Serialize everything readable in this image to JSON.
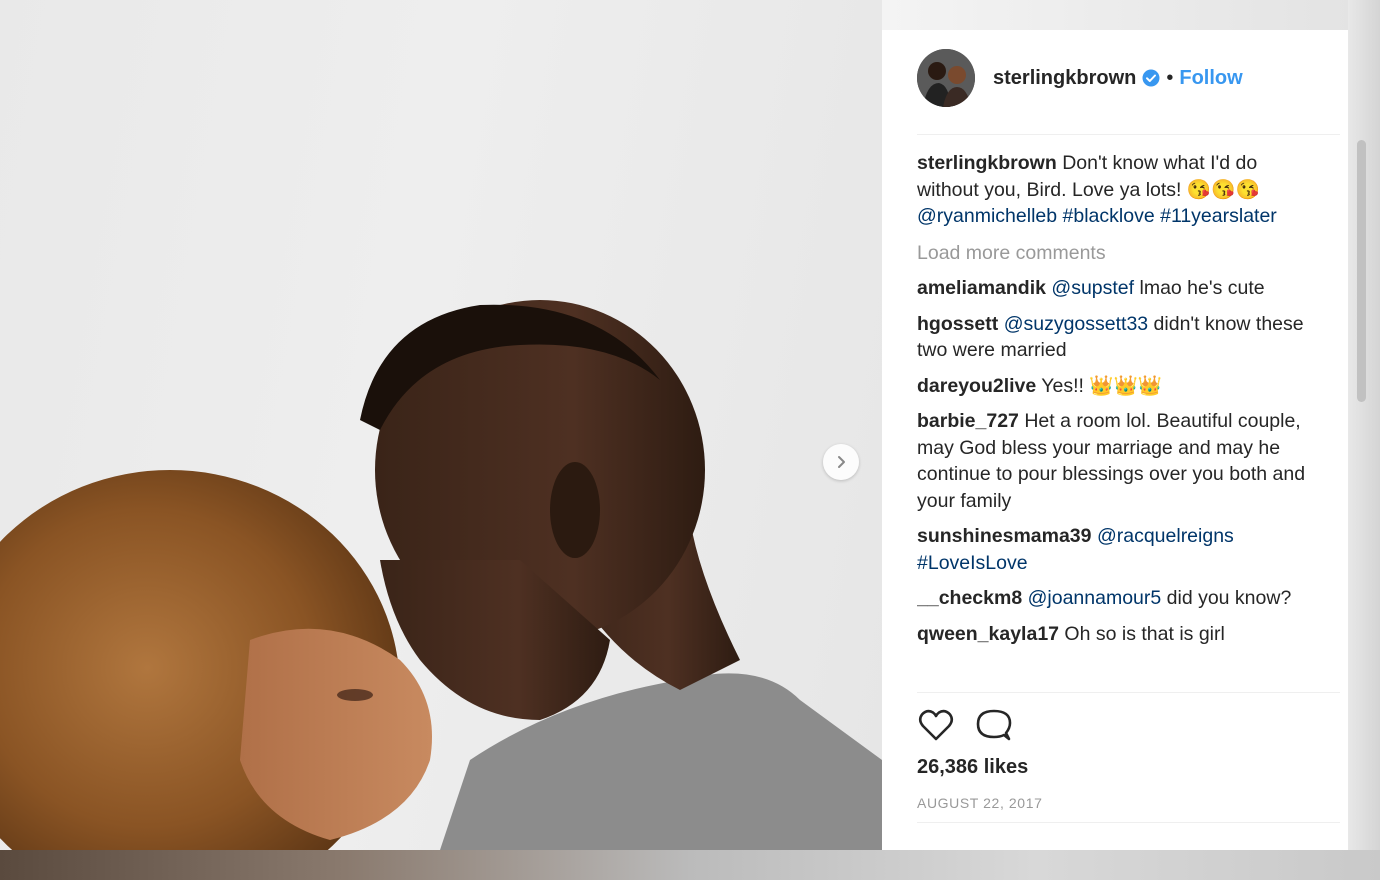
{
  "post": {
    "username": "sterlingkbrown",
    "follow_label": "Follow",
    "separator": "•",
    "caption": {
      "username": "sterlingkbrown",
      "text": " Don't know what I'd do without you, Bird. Love ya lots! ",
      "emojis": "😘😘😘",
      "tags": [
        " ",
        "@ryanmichelleb",
        " ",
        "#blacklove",
        " ",
        "#11yearslater"
      ]
    },
    "load_more_label": "Load more comments",
    "comments": [
      {
        "username": "ameliamandik",
        "mention": "@supstef",
        "text": " lmao he's cute"
      },
      {
        "username": "hgossett",
        "mention": "@suzygossett33",
        "text": " didn't know these two were married"
      },
      {
        "username": "dareyou2live",
        "mention": "",
        "text": " Yes!! 👑👑👑"
      },
      {
        "username": "barbie_727",
        "mention": "",
        "text": " Het a room lol. Beautiful couple, may God bless your marriage and may he continue to pour blessings over you both and your family"
      },
      {
        "username": "sunshinesmama39",
        "mention": "@racquelreigns",
        "text": " ",
        "mention2": "#LoveIsLove"
      },
      {
        "username": "__checkm8",
        "mention": "@joannamour5",
        "text": " did you know?"
      },
      {
        "username": "qween_kayla17",
        "mention": "",
        "text": " Oh so is that is girl"
      }
    ],
    "likes": "26,386 likes",
    "date": "AUGUST 22, 2017"
  },
  "icons": {
    "verified": "verified-badge-icon",
    "like": "heart-icon",
    "comment": "comment-bubble-icon",
    "next": "chevron-right-icon"
  },
  "colors": {
    "link": "#003569",
    "follow": "#3897f0",
    "text": "#262626",
    "muted": "#999999"
  }
}
